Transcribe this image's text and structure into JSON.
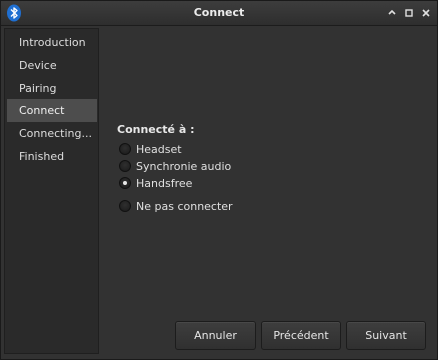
{
  "window": {
    "title": "Connect",
    "app_icon": "bluetooth-icon",
    "controls": [
      "minimize-icon",
      "maximize-icon",
      "close-icon"
    ]
  },
  "sidebar": {
    "items": [
      {
        "label": "Introduction",
        "active": false
      },
      {
        "label": "Device",
        "active": false
      },
      {
        "label": "Pairing",
        "active": false
      },
      {
        "label": "Connect",
        "active": true
      },
      {
        "label": "Connecting...",
        "active": false
      },
      {
        "label": "Finished",
        "active": false
      }
    ]
  },
  "main": {
    "heading": "Connecté à :",
    "options": [
      {
        "label": "Headset",
        "checked": false
      },
      {
        "label": "Synchronie audio",
        "checked": false
      },
      {
        "label": "Handsfree",
        "checked": true
      },
      {
        "label": "Ne pas connecter",
        "checked": false
      }
    ]
  },
  "buttons": {
    "cancel_label": "Annuler",
    "previous_label": "Précédent",
    "next_label": "Suivant"
  },
  "colors": {
    "window_bg": "#323232",
    "sidebar_bg": "#2a2a2a",
    "selection": "#4d4d4d",
    "bluetooth_blue": "#1f6fd1"
  }
}
